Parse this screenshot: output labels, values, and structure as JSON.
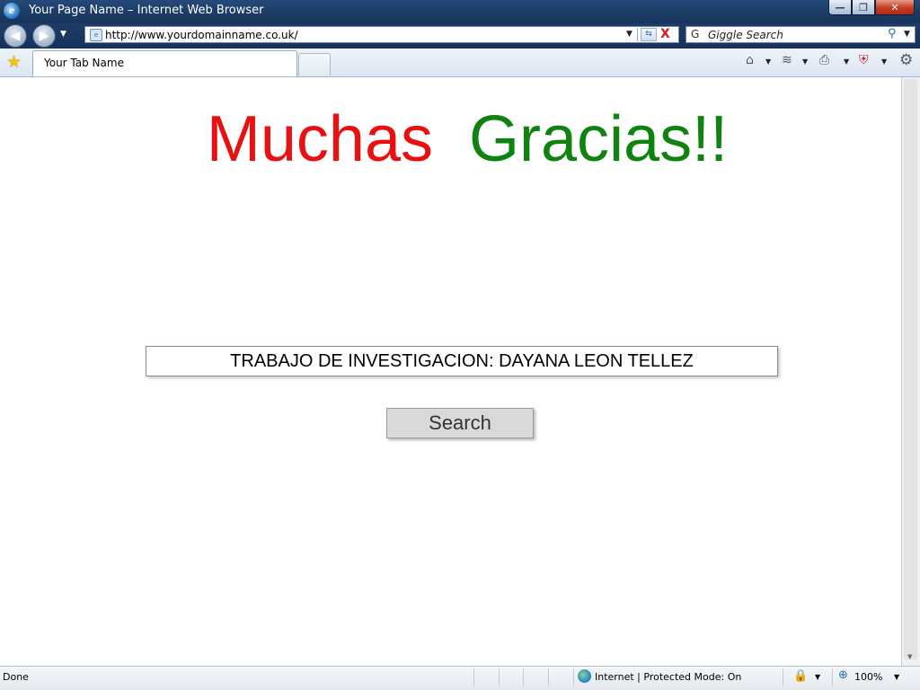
{
  "window": {
    "title": "Your Page Name – Internet Web Browser",
    "app_icon_letter": "e",
    "minimize_symbol": "—",
    "restore_symbol": "❐",
    "close_symbol": "✕"
  },
  "navigation": {
    "back_symbol": "◀",
    "forward_symbol": "▶",
    "dropdown_symbol": "▼",
    "url": "http://www.yourdomainname.co.uk/",
    "refresh_symbol": "⇆",
    "stop_symbol": "X"
  },
  "search": {
    "placeholder": "Giggle Search",
    "engine_icon": "G",
    "go_symbol": "⚲"
  },
  "tabs": {
    "active_tab": "Your Tab Name"
  },
  "commands": {
    "home_icon": "⌂",
    "feeds_icon": "≋",
    "print_icon": "⎙",
    "safety_icon": "⛨",
    "tools_icon": "⚙",
    "dropdown_symbol": "▼"
  },
  "page": {
    "headline_word1": "Muchas",
    "headline_word2": "Gracias!!",
    "query_text": "TRABAJO DE INVESTIGACION:  DAYANA LEON TELLEZ",
    "search_button": "Search"
  },
  "status": {
    "text": "Done",
    "zone": "Internet | Protected Mode: On",
    "zoom": "100%",
    "lock_icon": "🔒",
    "zoom_icon": "⊕"
  },
  "colors": {
    "headline_word1": "#e81010",
    "headline_word2": "#0f830f",
    "titlebar": "#1d3c66"
  }
}
